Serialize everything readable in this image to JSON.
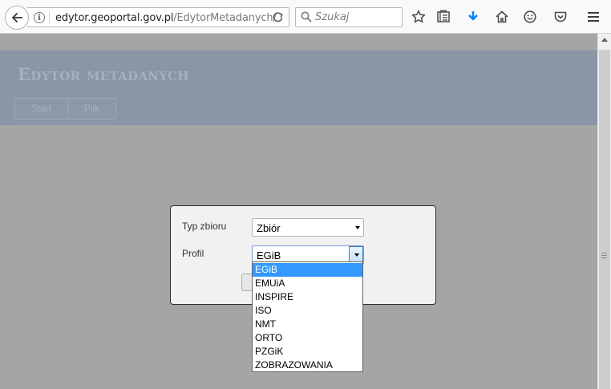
{
  "browser": {
    "url_host": "edytor.geoportal.gov.pl",
    "url_path": "/EdytorMetadanych/",
    "search_placeholder": "Szukaj"
  },
  "app": {
    "title": "Edytor metadanych",
    "nav": [
      {
        "label": "Start"
      },
      {
        "label": "Plik"
      }
    ]
  },
  "dialog": {
    "type_label": "Typ zbioru",
    "type_value": "Zbiór",
    "profile_label": "Profil",
    "profile_value": "EGiB",
    "profile_options": [
      "EGiB",
      "EMUiA",
      "INSPIRE",
      "ISO",
      "NMT",
      "ORTO",
      "PZGiK",
      "ZOBRAZOWANIA"
    ],
    "profile_selected_index": 0
  },
  "colors": {
    "overlay": "#a5a5a5",
    "header": "#8a95a5",
    "selection": "#3399ff"
  }
}
